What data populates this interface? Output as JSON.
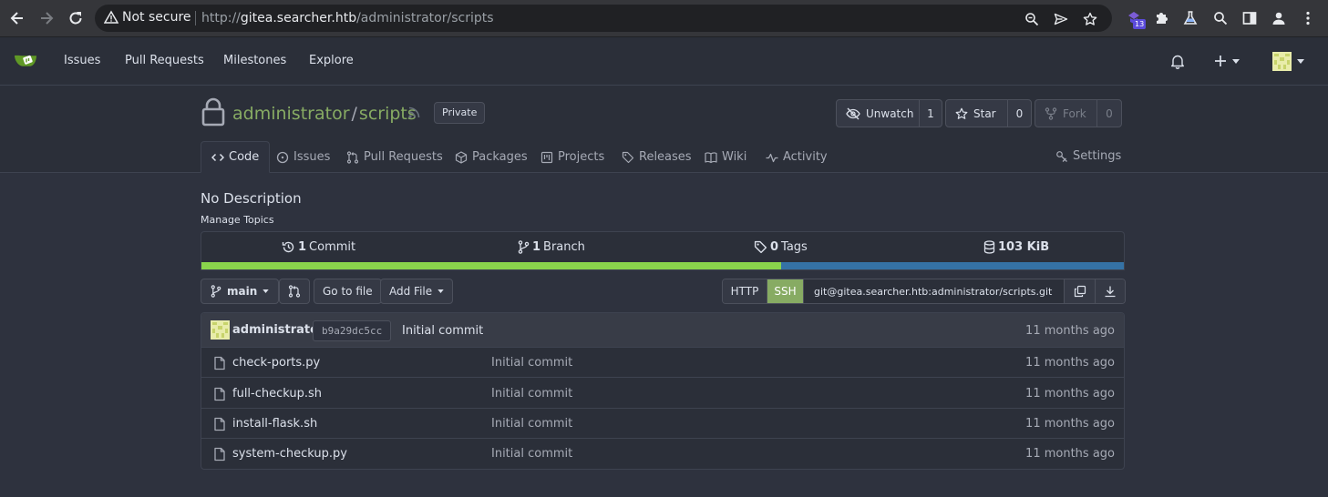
{
  "browser": {
    "security_label": "Not secure",
    "url_scheme": "http://",
    "url_host": "gitea.searcher.htb",
    "url_path": "/administrator/scripts",
    "extension_badge": "13"
  },
  "navbar": {
    "links": [
      "Issues",
      "Pull Requests",
      "Milestones",
      "Explore"
    ]
  },
  "repo": {
    "owner": "administrator",
    "separator": "/",
    "name": "scripts",
    "visibility": "Private",
    "unwatch_label": "Unwatch",
    "watch_count": "1",
    "star_label": "Star",
    "star_count": "0",
    "fork_label": "Fork",
    "fork_count": "0",
    "tabs": [
      "Code",
      "Issues",
      "Pull Requests",
      "Packages",
      "Projects",
      "Releases",
      "Wiki",
      "Activity"
    ],
    "settings_label": "Settings",
    "description": "No Description",
    "manage_topics": "Manage Topics"
  },
  "stats": {
    "commits_count": "1",
    "commits_label": "Commit",
    "branches_count": "1",
    "branches_label": "Branch",
    "tags_count": "0",
    "tags_label": "Tags",
    "size": "103 KiB",
    "language_fractions": [
      0.628,
      0.372
    ],
    "language_colors": [
      "#8ad44c",
      "#3572a5"
    ]
  },
  "toolbar": {
    "branch": "main",
    "go_to_file": "Go to file",
    "add_file": "Add File",
    "http_label": "HTTP",
    "ssh_label": "SSH",
    "clone_url": "git@gitea.searcher.htb:administrator/scripts.git"
  },
  "latest_commit": {
    "author": "administrator",
    "sha": "b9a29dc5cc",
    "message": "Initial commit",
    "time": "11 months ago"
  },
  "files": [
    {
      "name": "check-ports.py",
      "message": "Initial commit",
      "time": "11 months ago"
    },
    {
      "name": "full-checkup.sh",
      "message": "Initial commit",
      "time": "11 months ago"
    },
    {
      "name": "install-flask.sh",
      "message": "Initial commit",
      "time": "11 months ago"
    },
    {
      "name": "system-checkup.py",
      "message": "Initial commit",
      "time": "11 months ago"
    }
  ],
  "colors": {
    "accent": "#87ab63",
    "background": "#2e323e",
    "panel": "#2b2f39"
  }
}
